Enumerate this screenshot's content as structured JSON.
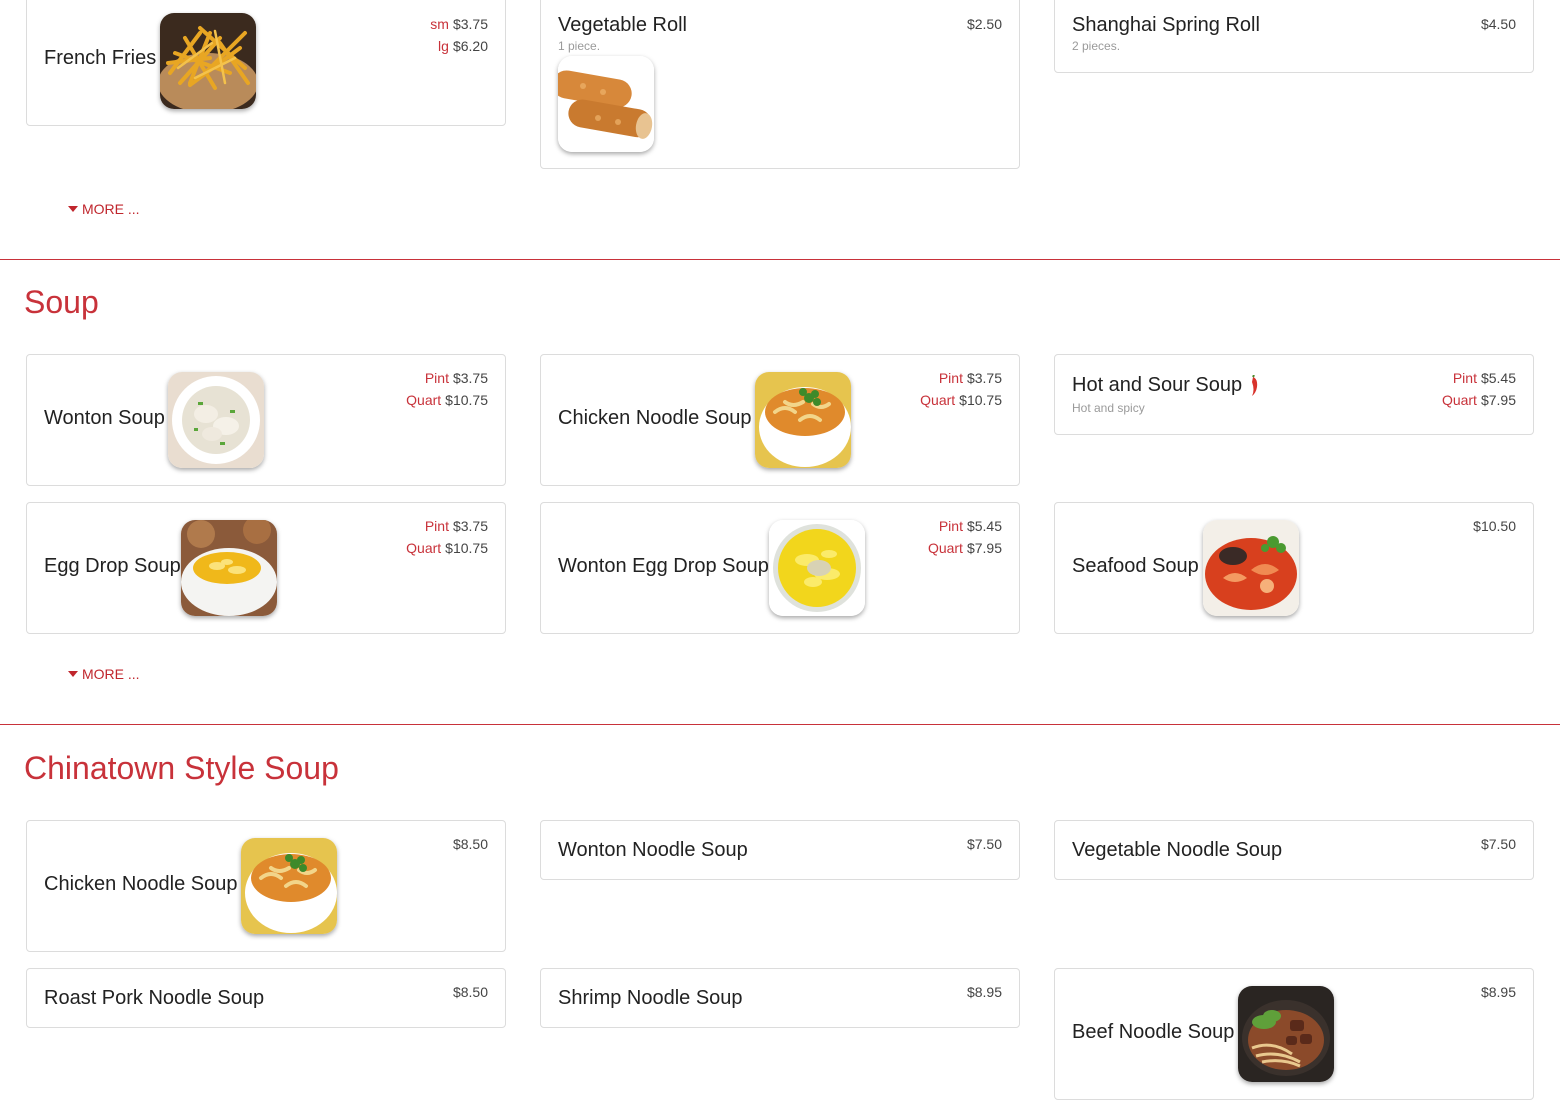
{
  "appetizers": {
    "more_label": "MORE ...",
    "items": [
      {
        "name": "French Fries",
        "prices": [
          {
            "label": "sm",
            "value": "$3.75"
          },
          {
            "label": "lg",
            "value": "$6.20"
          }
        ]
      },
      {
        "name": "Vegetable Roll",
        "description": "1 piece.",
        "price": "$2.50"
      },
      {
        "name": "Shanghai Spring Roll",
        "description": "2 pieces.",
        "price": "$4.50"
      }
    ]
  },
  "soup": {
    "title": "Soup",
    "more_label": "MORE ...",
    "items": [
      {
        "name": "Wonton Soup",
        "prices": [
          {
            "label": "Pint",
            "value": "$3.75"
          },
          {
            "label": "Quart",
            "value": "$10.75"
          }
        ]
      },
      {
        "name": "Chicken Noodle Soup",
        "prices": [
          {
            "label": "Pint",
            "value": "$3.75"
          },
          {
            "label": "Quart",
            "value": "$10.75"
          }
        ]
      },
      {
        "name": "Hot and Sour Soup",
        "description": "Hot and spicy",
        "spicy": true,
        "prices": [
          {
            "label": "Pint",
            "value": "$5.45"
          },
          {
            "label": "Quart",
            "value": "$7.95"
          }
        ]
      },
      {
        "name": "Egg Drop Soup",
        "prices": [
          {
            "label": "Pint",
            "value": "$3.75"
          },
          {
            "label": "Quart",
            "value": "$10.75"
          }
        ]
      },
      {
        "name": "Wonton Egg Drop Soup",
        "prices": [
          {
            "label": "Pint",
            "value": "$5.45"
          },
          {
            "label": "Quart",
            "value": "$7.95"
          }
        ]
      },
      {
        "name": "Seafood Soup",
        "price": "$10.50"
      }
    ]
  },
  "chinatown": {
    "title": "Chinatown Style Soup",
    "items": [
      {
        "name": "Chicken Noodle Soup",
        "price": "$8.50"
      },
      {
        "name": "Wonton Noodle Soup",
        "price": "$7.50"
      },
      {
        "name": "Vegetable Noodle Soup",
        "price": "$7.50"
      },
      {
        "name": "Roast Pork Noodle Soup",
        "price": "$8.50"
      },
      {
        "name": "Shrimp Noodle Soup",
        "price": "$8.95"
      },
      {
        "name": "Beef Noodle Soup",
        "price": "$8.95"
      }
    ]
  },
  "colors": {
    "accent": "#c8323a",
    "text": "#222222",
    "border": "#dcdcdc",
    "muted": "#9a9a9a"
  }
}
